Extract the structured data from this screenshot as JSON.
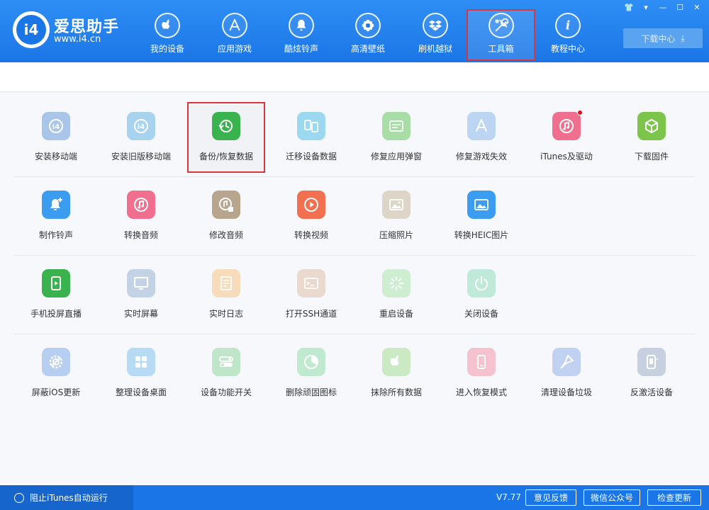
{
  "app": {
    "brand_name": "爱思助手",
    "brand_url": "www.i4.cn",
    "logo_text": "i4"
  },
  "nav": {
    "items": [
      {
        "label": "我的设备",
        "icon": "apple-icon"
      },
      {
        "label": "应用游戏",
        "icon": "app-store-icon"
      },
      {
        "label": "酷炫铃声",
        "icon": "bell-icon"
      },
      {
        "label": "高清壁纸",
        "icon": "flower-icon"
      },
      {
        "label": "刷机越狱",
        "icon": "dropbox-icon"
      },
      {
        "label": "工具箱",
        "icon": "tools-icon",
        "active": true
      },
      {
        "label": "教程中心",
        "icon": "info-icon"
      }
    ],
    "download_center": "下载中心"
  },
  "window_controls": [
    "shirt-icon",
    "dropdown-icon",
    "minimize-icon",
    "maximize-icon",
    "close-icon"
  ],
  "tools": {
    "rows": [
      [
        {
          "label": "安装移动端",
          "icon": "i4-icon",
          "color": "#a9c6ea"
        },
        {
          "label": "安装旧版移动端",
          "icon": "i4-icon",
          "color": "#a8d3ef"
        },
        {
          "label": "备份/恢复数据",
          "icon": "backup-clock-icon",
          "color": "#3ab24d",
          "selected": true
        },
        {
          "label": "迁移设备数据",
          "icon": "transfer-icon",
          "color": "#9cd9f0"
        },
        {
          "label": "修复应用弹窗",
          "icon": "apple-id-icon",
          "color": "#a9dda6"
        },
        {
          "label": "修复游戏失效",
          "icon": "app-store-icon",
          "color": "#bcd5f2"
        },
        {
          "label": "iTunes及驱动",
          "icon": "itunes-icon",
          "color": "#f06f8e",
          "badge": true
        },
        {
          "label": "下载固件",
          "icon": "cube-icon",
          "color": "#7cc44a"
        }
      ],
      [
        {
          "label": "制作铃声",
          "icon": "bell-plus-icon",
          "color": "#3c9cf0"
        },
        {
          "label": "转换音频",
          "icon": "music-icon",
          "color": "#f06f8e"
        },
        {
          "label": "修改音频",
          "icon": "music-edit-icon",
          "color": "#b8a58e"
        },
        {
          "label": "转换视频",
          "icon": "video-icon",
          "color": "#f07050"
        },
        {
          "label": "压缩照片",
          "icon": "photo-icon",
          "color": "#ddd5c8"
        },
        {
          "label": "转换HEIC图片",
          "icon": "heic-icon",
          "color": "#3c9cf0"
        }
      ],
      [
        {
          "label": "手机投屏直播",
          "icon": "screen-cast-icon",
          "color": "#3ab24d"
        },
        {
          "label": "实时屏幕",
          "icon": "monitor-icon",
          "color": "#c4d2e6"
        },
        {
          "label": "实时日志",
          "icon": "log-icon",
          "color": "#f7dcbc"
        },
        {
          "label": "打开SSH通道",
          "icon": "terminal-icon",
          "color": "#ead9cf"
        },
        {
          "label": "重启设备",
          "icon": "restart-icon",
          "color": "#cdeed0"
        },
        {
          "label": "关闭设备",
          "icon": "power-icon",
          "color": "#bfe9d8"
        }
      ],
      [
        {
          "label": "屏蔽iOS更新",
          "icon": "gear-block-icon",
          "color": "#b6cff0"
        },
        {
          "label": "整理设备桌面",
          "icon": "grid-icon",
          "color": "#b7dbf5"
        },
        {
          "label": "设备功能开关",
          "icon": "toggle-icon",
          "color": "#bfe6c8"
        },
        {
          "label": "删除顽固图标",
          "icon": "pie-icon",
          "color": "#c0ead0"
        },
        {
          "label": "抹除所有数据",
          "icon": "apple-icon",
          "color": "#c9eac3"
        },
        {
          "label": "进入恢复模式",
          "icon": "phone-restore-icon",
          "color": "#f5c3cf"
        },
        {
          "label": "清理设备垃圾",
          "icon": "broom-icon",
          "color": "#c1d1f2"
        },
        {
          "label": "反激活设备",
          "icon": "phone-off-icon",
          "color": "#c6d0e0"
        }
      ]
    ]
  },
  "status": {
    "block_itunes": "阻止iTunes自动运行",
    "version": "V7.77",
    "feedback": "意见反馈",
    "wechat": "微信公众号",
    "check_update": "检查更新"
  }
}
